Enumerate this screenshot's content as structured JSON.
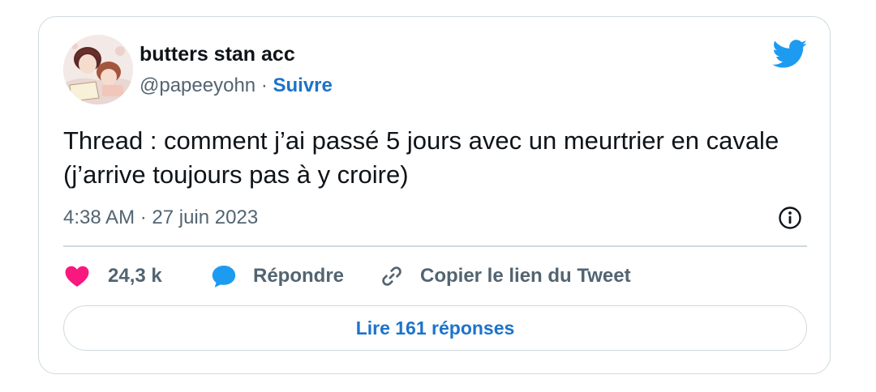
{
  "author": {
    "name": "butters stan acc",
    "handle": "@papeeyohn",
    "separator": " · ",
    "follow_label": "Suivre"
  },
  "tweet": {
    "text": "Thread : comment j’ai passé 5 jours avec un meurtrier en cavale (j’arrive toujours pas à y croire)",
    "timestamp": "4:38 AM · 27 juin 2023"
  },
  "actions": {
    "likes": "24,3 k",
    "reply_label": "Répondre",
    "copy_link_label": "Copier le lien du Tweet"
  },
  "read_replies_label": "Lire 161 réponses",
  "icons": {
    "brand": "twitter-bird-icon",
    "info": "info-icon",
    "like": "heart-icon",
    "reply": "speech-bubble-icon",
    "copy": "link-icon"
  },
  "colors": {
    "twitter_blue": "#1d9bf0",
    "link_blue": "#1d73c9",
    "heart": "#f91880",
    "secondary_text": "#536471",
    "border": "#cfd9de"
  }
}
